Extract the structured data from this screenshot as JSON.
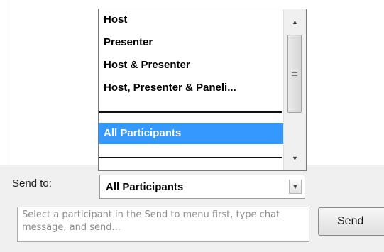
{
  "send_to": {
    "label": "Send to:",
    "selected": "All Participants"
  },
  "dropdown": {
    "options": [
      {
        "label": "Host"
      },
      {
        "label": "Presenter"
      },
      {
        "label": "Host & Presenter"
      },
      {
        "label": "Host, Presenter & Paneli..."
      },
      {
        "label": ""
      },
      {
        "label": "All Participants",
        "selected": true
      },
      {
        "label": ""
      }
    ]
  },
  "chat": {
    "placeholder": "Select a participant in the Send to menu first, type chat message, and send..."
  },
  "send_button": {
    "label": "Send"
  },
  "colors": {
    "selection": "#3399ff",
    "panel_bg": "#f0f0f0"
  },
  "icons": {
    "select_arrow": "chevron-down-icon",
    "scroll_up": "arrow-up-icon",
    "scroll_down": "arrow-down-icon"
  }
}
